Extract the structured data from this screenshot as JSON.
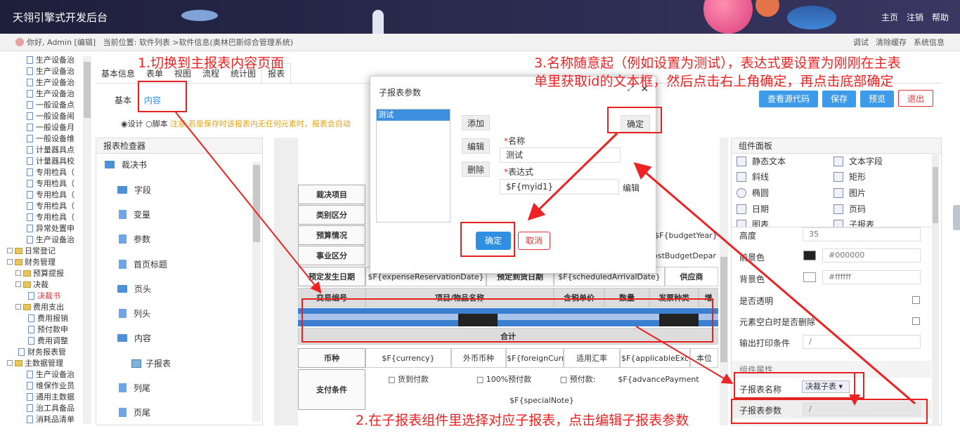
{
  "header": {
    "app_title": "天翎引擎式开发后台",
    "nav": [
      "主页",
      "注销",
      "帮助"
    ]
  },
  "crumb": {
    "user_text": "你好, Admin [编辑]",
    "location": "当前位置: 软件列表 >软件信息(奥林巴斯综合管理系统)",
    "actions": [
      "调试",
      "清除缓存",
      "系统信息"
    ]
  },
  "tree": {
    "items": [
      "生产设备治",
      "生产设备治",
      "生产设备治",
      "生产设备治",
      "一般设备点",
      "一般设备闹",
      "一般设备月",
      "一般设备维",
      "计量器具点",
      "计量器具校",
      "专用检具（",
      "专用检具（",
      "专用检具（",
      "专用检具（",
      "专用检具（",
      "异常处置申",
      "生产设备治"
    ],
    "groups": [
      {
        "label": "日常登记"
      },
      {
        "label": "财务管理"
      },
      {
        "label": "预算提报"
      },
      {
        "label": "决裁"
      },
      {
        "label": "决裁书"
      },
      {
        "label": "费用支出"
      },
      {
        "label": "费用报销"
      },
      {
        "label": "预付款申"
      },
      {
        "label": "费用调整"
      },
      {
        "label": "财务报表管"
      },
      {
        "label": "主数据管理"
      },
      {
        "label": "生产设备治"
      },
      {
        "label": "维保作业员"
      },
      {
        "label": "通用主数据"
      },
      {
        "label": "治工具备品"
      },
      {
        "label": "消耗品清单"
      }
    ]
  },
  "tabs": [
    "基本信息",
    "表单",
    "视图",
    "流程",
    "统计图",
    "报表"
  ],
  "subtabs": [
    "基本",
    "内容"
  ],
  "radios": {
    "design": "设计",
    "script": "脚本",
    "warning": "注意:若是保存时该报表内无任何元素时，报表会自动"
  },
  "toolbar": {
    "view_source": "查看源代码",
    "save": "保存",
    "preview": "预览",
    "exit": "退出"
  },
  "inspector": {
    "title": "报表检查器",
    "items": [
      "裁决书",
      "字段",
      "变量",
      "参数",
      "首页标题",
      "页头",
      "列头",
      "内容",
      "子报表",
      "列尾",
      "页尾"
    ]
  },
  "canvas": {
    "rows": [
      "裁决项目",
      "类别区分",
      "预算情况",
      "事业区分",
      "预定发生日期"
    ],
    "cells": {
      "budgetYear": "$F{budgetYear}",
      "costBudgetDepar": "costBudgetDepar",
      "expenseReservationDate": "$F{expenseReservationDate}",
      "arrival_label": "预定到货日期",
      "scheduledArrivalDate": "$F{scheduledArrivalDate}",
      "supplier": "供应商"
    },
    "header_cols": [
      "交易编号",
      "项目/物品名称",
      "含税单价",
      "数量",
      "发票种类",
      "增"
    ],
    "total": "合计",
    "currency_label": "币种",
    "currency": "$F{currency}",
    "foreign_label": "外币币种",
    "foreignCurre": "$F{foreignCurre",
    "rate_label": "适用汇率",
    "applicableEx": "$F{applicableExc",
    "base_label": "本位",
    "payment_label": "支付条件",
    "pay_opts": [
      "□ 货到付款",
      "□ 100%预付款",
      "□ 预付款:"
    ],
    "advancePayment": "$F{advancePayment",
    "specialNote": "$F{specialNote}"
  },
  "palette": {
    "title": "组件面板",
    "items": [
      "静态文本",
      "文本字段",
      "斜线",
      "矩形",
      "椭圆",
      "图片",
      "日期",
      "页码",
      "图表",
      "子报表"
    ]
  },
  "props": {
    "height_label": "高度",
    "height_value": "35",
    "fg_label": "前景色",
    "fg_value": "#000000",
    "bg_label": "背景色",
    "bg_value": "#ffffff",
    "transparent_label": "是否透明",
    "hide_empty_label": "元素空白时是否删除",
    "print_cond_label": "输出打印条件",
    "print_cond_value": "/",
    "section_label": "组件属性",
    "subreport_name_label": "子报表名称",
    "subreport_name_value": "决裁子表",
    "subreport_param_label": "子报表参数",
    "subreport_param_value": "/"
  },
  "modal": {
    "title": "子报表参数",
    "list_item": "测试",
    "add": "添加",
    "edit": "编辑",
    "delete": "删除",
    "name_label": "名称",
    "name_value": "测试",
    "expr_label": "表达式",
    "expr_value": "$F{myid1}",
    "expr_edit": "编辑",
    "confirm_top": "确定",
    "confirm": "确定",
    "cancel": "取消"
  },
  "annotations": {
    "a1": "1.切换到主报表内容页面",
    "a2": "2.在子报表组件里选择对应子报表，点击编辑子报表参数",
    "a3_line1": "3.名称随意起（例如设置为测试），表达式要设置为刚刚在主表",
    "a3_line2": "单里获取id的文本框，然后点击右上角确定，再点击底部确定"
  },
  "colors": {
    "accent": "#3d9be9",
    "annotation": "#ee2222",
    "header": "#2c2d52"
  }
}
